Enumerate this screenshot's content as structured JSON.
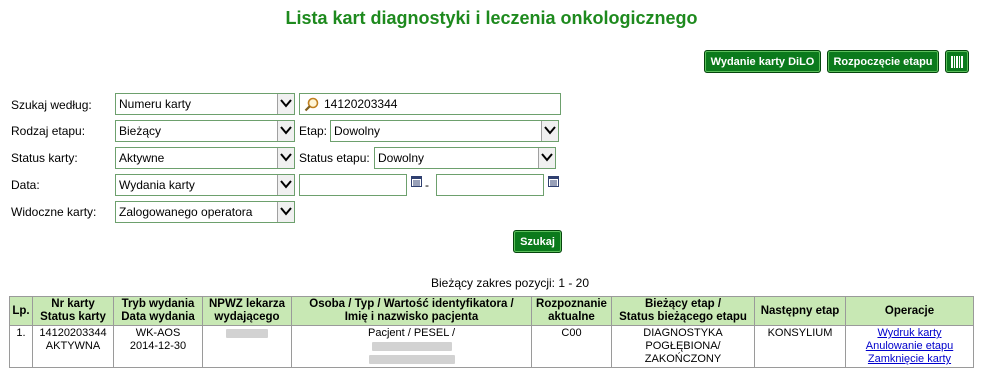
{
  "page": {
    "title": "Lista kart diagnostyki i leczenia onkologicznego"
  },
  "toolbar": {
    "issue_card": "Wydanie karty DiLO",
    "start_stage": "Rozpoczęcie etapu"
  },
  "search": {
    "by_label": "Szukaj według:",
    "by_value": "Numeru karty",
    "query_value": "14120203344",
    "stage_type_label": "Rodzaj etapu:",
    "stage_type_value": "Bieżący",
    "stage_label": "Etap:",
    "stage_value": "Dowolny",
    "card_status_label": "Status karty:",
    "card_status_value": "Aktywne",
    "stage_status_label": "Status etapu:",
    "stage_status_value": "Dowolny",
    "date_label": "Data:",
    "date_value": "Wydania karty",
    "date_sep": "-",
    "visible_label": "Widoczne karty:",
    "visible_value": "Zalogowanego operatora",
    "submit": "Szukaj"
  },
  "range_info": "Bieżący zakres pozycji: 1 - 20",
  "table": {
    "headers": [
      [
        "Lp.",
        ""
      ],
      [
        "Nr karty",
        "Status karty"
      ],
      [
        "Tryb wydania",
        "Data wydania"
      ],
      [
        "NPWZ lekarza",
        "wydającego"
      ],
      [
        "Osoba / Typ / Wartość identyfikatora /",
        "Imię i nazwisko pacjenta"
      ],
      [
        "Rozpoznanie",
        "aktualne"
      ],
      [
        "Bieżący etap /",
        "Status bieżącego etapu"
      ],
      [
        "Następny etap",
        ""
      ],
      [
        "Operacje",
        ""
      ]
    ],
    "rows": [
      {
        "lp": "1.",
        "card_no": "14120203344",
        "card_status": "AKTYWNA",
        "mode": "WK-AOS",
        "date": "2014-12-30",
        "person_type": "Pacjent / PESEL /",
        "diagnosis": "C00",
        "stage_1": "DIAGNOSTYKA",
        "stage_2": "POGŁĘBIONA/",
        "stage_3": "ZAKOŃCZONY",
        "next_stage": "KONSYLIUM",
        "ops": [
          "Wydruk karty",
          "Anulowanie etapu",
          "Zamknięcie karty"
        ]
      }
    ]
  }
}
